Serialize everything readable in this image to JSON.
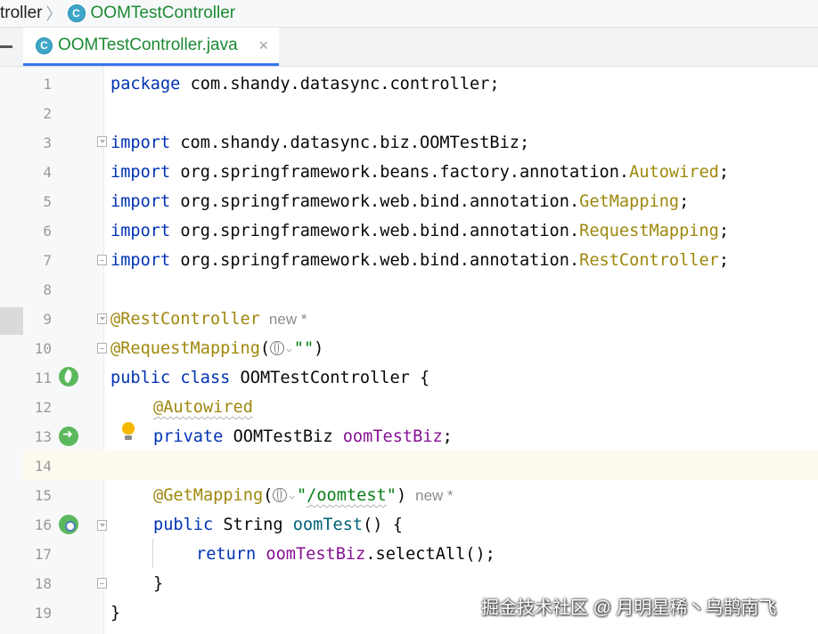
{
  "breadcrumb": {
    "parent": "troller",
    "current": "OOMTestController",
    "class_icon_letter": "C"
  },
  "tabs": [
    {
      "label": "OOMTestController.java",
      "icon_letter": "C",
      "close": "×",
      "active": true
    }
  ],
  "colors": {
    "keyword": "#0033b3",
    "annotation": "#9e880d",
    "field": "#871094",
    "method": "#00627a",
    "string": "#067d17",
    "current_line": "#fdfbee"
  },
  "code": {
    "line_numbers": [
      "1",
      "2",
      "3",
      "4",
      "5",
      "6",
      "7",
      "8",
      "9",
      "10",
      "11",
      "12",
      "13",
      "14",
      "15",
      "16",
      "17",
      "18",
      "19"
    ],
    "l1": {
      "kw": "package",
      "rest": " com.shandy.datasync.controller;"
    },
    "l3": {
      "kw": "import",
      "rest": " com.shandy.datasync.biz.OOMTestBiz;"
    },
    "l4": {
      "kw": "import",
      "pkg": " org.springframework.beans.factory.annotation.",
      "cls": "Autowired",
      "end": ";"
    },
    "l5": {
      "kw": "import",
      "pkg": " org.springframework.web.bind.annotation.",
      "cls": "GetMapping",
      "end": ";"
    },
    "l6": {
      "kw": "import",
      "pkg": " org.springframework.web.bind.annotation.",
      "cls": "RequestMapping",
      "end": ";"
    },
    "l7": {
      "kw": "import",
      "pkg": " org.springframework.web.bind.annotation.",
      "cls": "RestController",
      "end": ";"
    },
    "l9": {
      "ann": "@RestController",
      "hint": "new *"
    },
    "l10": {
      "ann": "@RequestMapping",
      "open": "(",
      "value": "\"\"",
      "close": ")"
    },
    "l11": {
      "kw1": "public",
      "kw2": "class",
      "rest": " OOMTestController {"
    },
    "l12": {
      "ann": "@Autowired"
    },
    "l13": {
      "kw": "private",
      "type": " OOMTestBiz ",
      "field": "oomTestBiz",
      "end": ";"
    },
    "l15": {
      "ann": "@GetMapping",
      "open": "(",
      "value_q1": "\"",
      "value": "/oomtest",
      "value_q2": "\"",
      "close": ")",
      "hint": "new *"
    },
    "l16": {
      "kw": "public",
      "type": " String ",
      "method": "oomTest",
      "rest": "() {"
    },
    "l17": {
      "kw": "return",
      "field": "oomTestBiz",
      "rest": ".selectAll();"
    },
    "l18": {
      "rest": "}"
    },
    "l19": {
      "rest": "}"
    }
  },
  "gutter_icons": {
    "l11": "spring-bean-icon",
    "l13": "navigate-autowired-icon",
    "l16": "web-endpoint-icon",
    "l13_bulb": "intention-bulb-icon"
  },
  "watermark": "掘金技术社区 @ 月明星稀丶乌鹊南飞"
}
